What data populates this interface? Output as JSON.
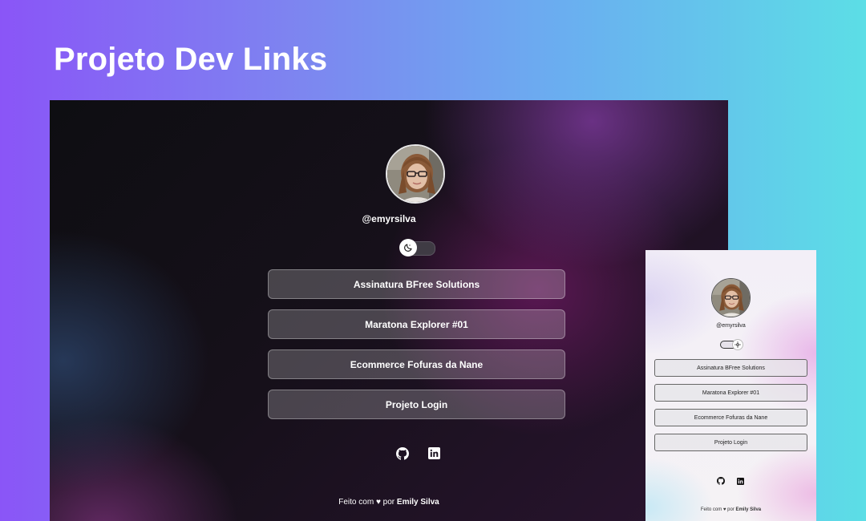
{
  "page": {
    "title": "Projeto Dev Links"
  },
  "desktop": {
    "username": "@emyrsilva",
    "links": [
      {
        "label": "Assinatura BFree Solutions"
      },
      {
        "label": "Maratona Explorer #01"
      },
      {
        "label": "Ecommerce Fofuras da Nane"
      },
      {
        "label": "Projeto Login"
      }
    ],
    "social": [
      "github-icon",
      "linkedin-icon"
    ],
    "footer": {
      "prefix": "Feito com",
      "heart": "♥",
      "by": "por",
      "author": "Emily Silva"
    },
    "theme": "dark"
  },
  "mobile": {
    "username": "@emyrsilva",
    "links": [
      {
        "label": "Assinatura BFree Solutions"
      },
      {
        "label": "Maratona Explorer #01"
      },
      {
        "label": "Ecommerce Fofuras da Nane"
      },
      {
        "label": "Projeto Login"
      }
    ],
    "social": [
      "github-icon",
      "linkedin-icon"
    ],
    "footer": {
      "prefix": "Feito com",
      "heart": "♥",
      "by": "por",
      "author": "Emily Silva"
    },
    "theme": "light"
  },
  "colors": {
    "background_start": "#8a55f7",
    "background_end": "#5cdee6",
    "desktop_bg": "#16101a",
    "desktop_accent": "#69195f",
    "text_light": "#ffffff",
    "text_dark": "#222222"
  }
}
